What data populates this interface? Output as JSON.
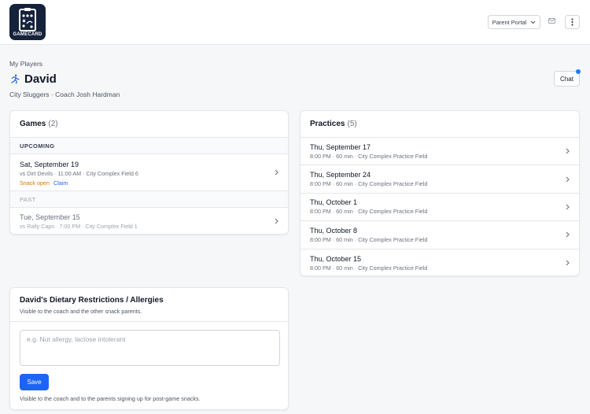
{
  "header": {
    "logo_text": "GAMECARD",
    "portal_label": "Parent Portal",
    "icons": {
      "mail": "mail-icon",
      "menu": "kebab-menu-icon"
    }
  },
  "breadcrumb": "My Players",
  "player": {
    "name": "David",
    "icon": "running-person-icon",
    "team_line": "City Sluggers · Coach Josh Hardman"
  },
  "chat": {
    "label": "Chat",
    "has_notification": true
  },
  "games": {
    "title": "Games",
    "count": "(2)",
    "upcoming_label": "UPCOMING",
    "past_label": "PAST",
    "upcoming": [
      {
        "date": "Sat, September 19",
        "details": "vs Dirt Devils · 11:00 AM · City Complex Field 6",
        "snack_status": "Snack open",
        "claim_label": "Claim"
      }
    ],
    "past": [
      {
        "date": "Tue, September 15",
        "details": "vs Rally Caps · 7:00 PM · City Complex Field 1"
      }
    ]
  },
  "practices": {
    "title": "Practices",
    "count": "(5)",
    "items": [
      {
        "date": "Thu, September 17",
        "details": "8:00 PM · 60 min · City Complex Practice Field"
      },
      {
        "date": "Thu, September 24",
        "details": "8:00 PM · 60 min · City Complex Practice Field"
      },
      {
        "date": "Thu, October 1",
        "details": "8:00 PM · 60 min · City Complex Practice Field"
      },
      {
        "date": "Thu, October 8",
        "details": "8:00 PM · 60 min · City Complex Practice Field"
      },
      {
        "date": "Thu, October 15",
        "details": "8:00 PM · 60 min · City Complex Practice Field"
      }
    ]
  },
  "dietary": {
    "title": "David's Dietary Restrictions / Allergies",
    "subtitle": "Visible to the coach and the other snack parents.",
    "value": "",
    "placeholder": "e.g. Nut allergy, lactose intolerant",
    "save_label": "Save",
    "footnote": "Visible to the coach and to the parents signing up for post-game snacks."
  },
  "colors": {
    "accent": "#1d63f5",
    "snack_open": "#d97706",
    "link": "#2563eb",
    "logo_bg": "#16223b"
  }
}
